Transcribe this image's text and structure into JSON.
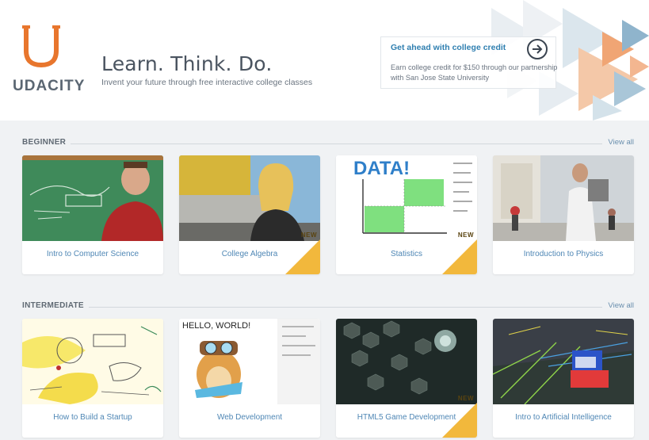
{
  "brand": {
    "name": "UDACITY",
    "accent": "#e8762d"
  },
  "hero": {
    "headline": "Learn. Think. Do.",
    "subline": "Invent your future through free interactive college classes"
  },
  "promo": {
    "title": "Get ahead with college credit",
    "text": "Earn college credit for $150 through our partnership with San Jose State University",
    "icon": "arrow-right-circle-icon"
  },
  "sections": [
    {
      "label": "BEGINNER",
      "view_all": "View all",
      "courses": [
        {
          "title": "Intro to Computer Science",
          "new": false
        },
        {
          "title": "College Algebra",
          "new": true,
          "badge": "NEW"
        },
        {
          "title": "Statistics",
          "new": true,
          "badge": "NEW"
        },
        {
          "title": "Introduction to Physics",
          "new": false
        }
      ]
    },
    {
      "label": "INTERMEDIATE",
      "view_all": "View all",
      "courses": [
        {
          "title": "How to Build a Startup",
          "new": false
        },
        {
          "title": "Web Development",
          "new": false
        },
        {
          "title": "HTML5 Game Development",
          "new": true,
          "badge": "NEW"
        },
        {
          "title": "Intro to Artificial Intelligence",
          "new": false
        }
      ]
    }
  ],
  "thumb_text": {
    "statistics_word": "DATA!",
    "webdev_word": "HELLO, WORLD!"
  }
}
